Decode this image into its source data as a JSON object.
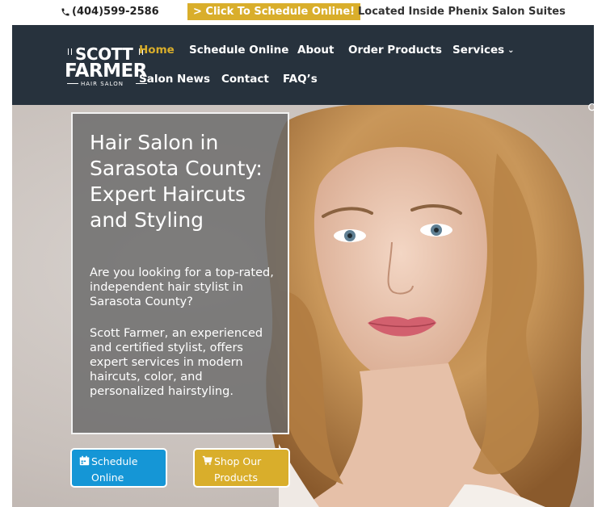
{
  "topbar": {
    "phone": "(404)599-2586",
    "schedule_link": "> Click To Schedule Online!",
    "location": "Located Inside Phenix Salon Suites"
  },
  "logo": {
    "line1": "SCOTT",
    "line2": "FARMER",
    "line3": "HAIR SALON"
  },
  "nav": {
    "items": [
      {
        "label": "Home",
        "active": true
      },
      {
        "label": "Schedule Online"
      },
      {
        "label": "About"
      },
      {
        "label": "Order Products"
      },
      {
        "label": "Services"
      },
      {
        "label": "Salon News"
      },
      {
        "label": "Contact"
      },
      {
        "label": "FAQ’s"
      }
    ]
  },
  "hero": {
    "title": "Hair Salon in Sarasota County: Expert Haircuts and Styling",
    "paragraph1": "Are you looking for a top-rated, independent hair stylist in Sarasota County?",
    "paragraph2": "Scott Farmer, an experienced and certified stylist, offers expert services in modern haircuts, color, and personalized hairstyling."
  },
  "buttons": {
    "schedule": {
      "line1": "Schedule",
      "line2": "Online"
    },
    "shop": {
      "line1": "Shop Our",
      "line2": "Products"
    }
  },
  "colors": {
    "accent_gold": "#d9ae2b",
    "header_dark": "#27323d",
    "button_blue": "#1596d6"
  },
  "icons": {
    "phone": "phone-icon",
    "calendar": "calendar-icon",
    "cart": "cart-icon",
    "search": "search-icon"
  }
}
